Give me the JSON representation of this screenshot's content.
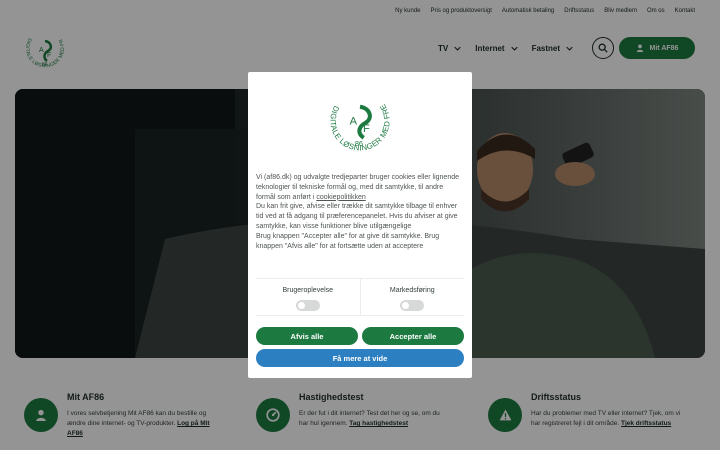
{
  "topbar": {
    "links": [
      "Ny kunde",
      "Pris og produktoversigt",
      "Automatisk betaling",
      "Driftsstatus",
      "Bliv medlem",
      "Om os",
      "Kontakt"
    ]
  },
  "logo": {
    "ring_text": "DIGITALE LØSNINGER MED FREMSYN",
    "letters": "AF",
    "number": "86",
    "brand_color": "#1c7a41"
  },
  "nav": {
    "items": [
      "TV",
      "Internet",
      "Fastnet"
    ],
    "search_icon": "search-icon",
    "account_button": "Mit AF86"
  },
  "features": [
    {
      "title": "Mit AF86",
      "text": "I vores selvbetjening Mit AF86 kan du bestille og ændre dine internet- og TV-produkter.",
      "link": "Log på Mit AF86",
      "icon": "user-icon"
    },
    {
      "title": "Hastighedstest",
      "text": "Er der fut i dit internet? Test det her og se, om du har hul igennem.",
      "link": "Tag hastighedstest",
      "icon": "speedometer-icon"
    },
    {
      "title": "Driftsstatus",
      "text": "Har du problemer med TV eller internet? Tjek, om vi har registreret fejl i dit område.",
      "link": "Tjek driftsstatus",
      "icon": "warning-icon"
    }
  ],
  "cookie_modal": {
    "text_part1": "Vi (af86.dk) og udvalgte tredjeparter bruger cookies eller lignende teknologier til tekniske formål og, med dit samtykke, til andre formål som anført i",
    "policy_link": "cookiepolitikken",
    "text_part2": "Du kan frit give, afvise eller trække dit samtykke tilbage til enhver tid ved at få adgang til præferencepanelet. Hvis du afviser at give samtykke, kan visse funktioner blive utilgængelige",
    "text_part3": "Brug knappen \"Accepter alle\" for at give dit samtykke. Brug knappen \"Afvis alle\" for at fortsætte uden at acceptere",
    "preferences": [
      "Brugeroplevelse",
      "Markedsføring"
    ],
    "decline_button": "Afvis alle",
    "accept_button": "Accepter alle",
    "more_button": "Få mere at vide",
    "button_color": "#1c7a41",
    "more_color": "#2c7fc1"
  }
}
